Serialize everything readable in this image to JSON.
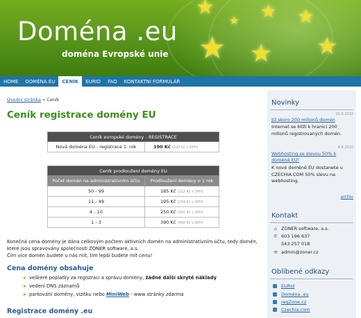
{
  "header": {
    "title": "Doména .eu",
    "subtitle": "doména Evropské unie"
  },
  "nav": [
    {
      "label": "HOME",
      "active": false
    },
    {
      "label": "DOMÉNA EU",
      "active": false
    },
    {
      "label": "CENÍK",
      "active": true
    },
    {
      "label": "EURID",
      "active": false
    },
    {
      "label": "FAQ",
      "active": false
    },
    {
      "label": "KONTAKTNÍ FORMULÁŘ",
      "active": false
    }
  ],
  "breadcrumb": {
    "home": "Úvodní stránka",
    "separator": "»",
    "current": "Ceník"
  },
  "page_title": "Ceník registrace domény EU",
  "registration_table": {
    "caption": "Ceník evropské domény - REGISTRACE",
    "row": {
      "label": "Nová doména EU - registrace 1. rok",
      "price": "190 Kč",
      "vat": "(228 Kč s DPH)"
    }
  },
  "renewal_table": {
    "caption": "Ceník prodloužení domény EU",
    "headers": [
      "Počet domén na administrativním účtu",
      "Prodloužení domény o 1 rok"
    ],
    "rows": [
      {
        "count": "50 - 99",
        "price": "185 Kč",
        "vat": "(222 Kč s DPH)"
      },
      {
        "count": "11 - 49",
        "price": "195 Kč",
        "vat": "(234 Kč s DPH)"
      },
      {
        "count": "4 - 10",
        "price": "250 Kč",
        "vat": "(300 Kč s DPH)"
      },
      {
        "count": "1 - 3",
        "price": "390 Kč",
        "vat": "(468 Kč s DPH)"
      }
    ]
  },
  "intro": {
    "line1": "Konečná cena domény je dána celkovým počtem aktivních domén na administrativním účtu, tedy domén,",
    "line2": "které jsou spravovány společností ZONER software, a.s.",
    "line3": "Čím více domén budete u nás mít, tím lepší budete mít cenu!"
  },
  "includes": {
    "heading": "Cena domény obsahuje",
    "item1_text": "veškeré poplatky za registraci a správu domény, ",
    "item1_bold": "žádné další skryté náklady",
    "item2": "vedení DNS záznamů",
    "item3_before": "parkování domény, vizitku nebo ",
    "item3_link": "MiniWeb",
    "item3_after": " - www stránky zdarma"
  },
  "registration_heading": "Registrace domény .eu",
  "sidebar": {
    "news": {
      "heading": "Novinky",
      "items": [
        {
          "date": "20.8.2010",
          "title": "Již skoro 200 milionů domén",
          "text": "Internet se blíží k hranici 200 milionů registrovaných domén."
        },
        {
          "date": "4.8.2010",
          "title": "Webhosting se slevou 50% k doméně EU!",
          "text": "K nové doméně EU dostanete u CZECHIA.COM 50% slevu na webhosting."
        }
      ],
      "archive": "archiv"
    },
    "contact": {
      "heading": "Kontakt",
      "company": "ZONER software, a.s.",
      "phone1": "603 196 637",
      "phone2": "543 257 018",
      "email": "admin@zoner.cz"
    },
    "favorites": {
      "heading": "Oblíbené odkazy",
      "links": [
        "EURid",
        "Doména .eu",
        "regZone.cz",
        "Czechia.com"
      ]
    }
  }
}
